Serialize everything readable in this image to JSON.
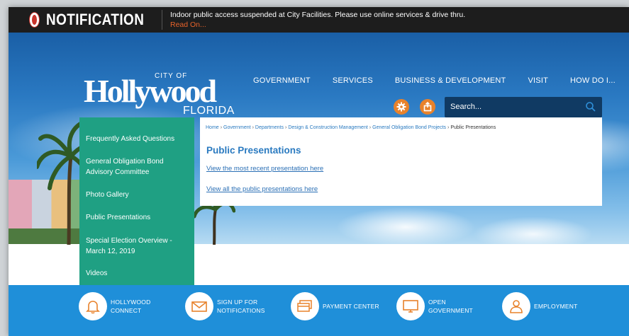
{
  "notification": {
    "title": "NOTIFICATION",
    "message": "Indoor public access suspended at City Facilities. Please use online services & drive thru.",
    "read_on": "Read On..."
  },
  "logo": {
    "city_of": "CITY OF",
    "name": "Hollywood",
    "state": "FLORIDA"
  },
  "nav": {
    "items": [
      "GOVERNMENT",
      "SERVICES",
      "BUSINESS & DEVELOPMENT",
      "VISIT",
      "HOW DO I..."
    ]
  },
  "search": {
    "placeholder": "Search..."
  },
  "sidebar": {
    "items": [
      "Frequently Asked Questions",
      "General Obligation Bond Advisory Committee",
      "Photo Gallery",
      "Public Presentations",
      "Special Election Overview - March 12, 2019",
      "Videos"
    ]
  },
  "breadcrumb": {
    "items": [
      "Home",
      "Government",
      "Departments",
      "Design & Construction Management",
      "General Obligation Bond Projects"
    ],
    "current": "Public Presentations",
    "separator": "›"
  },
  "content": {
    "title": "Public Presentations",
    "link1": "View the most recent presentation here",
    "link2": "View all the public presentations here"
  },
  "footer": {
    "quick_links": [
      {
        "label": "HOLLYWOOD CONNECT",
        "icon": "bell-icon"
      },
      {
        "label": "SIGN UP FOR NOTIFICATIONS",
        "icon": "envelope-icon"
      },
      {
        "label": "PAYMENT CENTER",
        "icon": "credit-card-icon"
      },
      {
        "label": "OPEN GOVERNMENT",
        "icon": "monitor-icon"
      },
      {
        "label": "EMPLOYMENT",
        "icon": "person-icon"
      }
    ]
  },
  "colors": {
    "notification_bar": "#1d1d1d",
    "accent_orange": "#e8822b",
    "sidebar_green": "#1fa083",
    "link_blue": "#2a7ac0",
    "footer_blue": "#1f8fd9"
  }
}
